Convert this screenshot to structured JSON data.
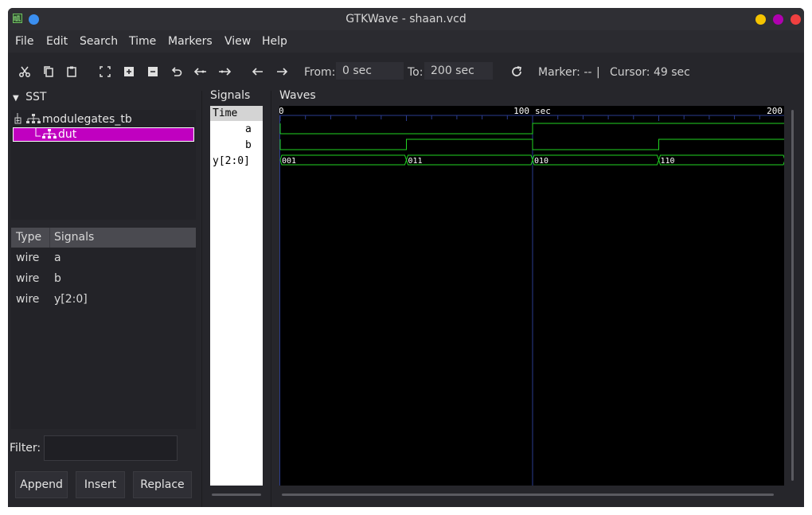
{
  "window": {
    "title": "GTKWave - shaan.vcd",
    "buttons": {
      "minimize_color": "#f5c400",
      "maximize_color": "#b000b0",
      "close_color": "#f04040"
    }
  },
  "menu": [
    "File",
    "Edit",
    "Search",
    "Time",
    "Markers",
    "View",
    "Help"
  ],
  "toolbar": {
    "icons": [
      "cut-icon",
      "copy-icon",
      "paste-icon",
      "zoom-fit-icon",
      "zoom-in-icon",
      "zoom-out-icon",
      "undo-icon",
      "zoom-to-start-icon",
      "zoom-to-end-icon",
      "arrow-left-icon",
      "arrow-right-icon",
      "reload-icon"
    ],
    "from_label": "From:",
    "from_value": "0 sec",
    "to_label": "To:",
    "to_value": "200 sec",
    "marker": "Marker: --",
    "separator": "|",
    "cursor": "Cursor: 49 sec"
  },
  "sst": {
    "title": "SST",
    "tree": [
      {
        "label": "modulegates_tb",
        "selected": false
      },
      {
        "label": "dut",
        "selected": true
      }
    ]
  },
  "signal_list": {
    "headers": [
      "Type",
      "Signals"
    ],
    "rows": [
      {
        "type": "wire",
        "name": "a"
      },
      {
        "type": "wire",
        "name": "b"
      },
      {
        "type": "wire",
        "name": "y[2:0]"
      }
    ]
  },
  "filter": {
    "label": "Filter:",
    "value": ""
  },
  "buttons": {
    "append": "Append",
    "insert": "Insert",
    "replace": "Replace"
  },
  "signals_pane": {
    "title": "Signals",
    "time_label": "Time",
    "rows": [
      "a",
      "b",
      "y[2:0]"
    ]
  },
  "waves": {
    "title": "Waves",
    "ruler_labels": [
      "0",
      "100",
      "sec",
      "200"
    ],
    "time_range": [
      0,
      200
    ],
    "cursor_time": 49,
    "marker_time": 100,
    "colors": {
      "background": "#000000",
      "trace": "#22d322",
      "marker": "#2a3b8f"
    },
    "signal_a": [
      {
        "t": 0,
        "v": 0
      },
      {
        "t": 100,
        "v": 1
      }
    ],
    "signal_b": [
      {
        "t": 0,
        "v": 0
      },
      {
        "t": 50,
        "v": 1
      },
      {
        "t": 100,
        "v": 0
      },
      {
        "t": 150,
        "v": 1
      }
    ],
    "bus_y": [
      {
        "t": 0,
        "value": "001"
      },
      {
        "t": 50,
        "value": "011"
      },
      {
        "t": 100,
        "value": "010"
      },
      {
        "t": 150,
        "value": "110"
      }
    ]
  }
}
